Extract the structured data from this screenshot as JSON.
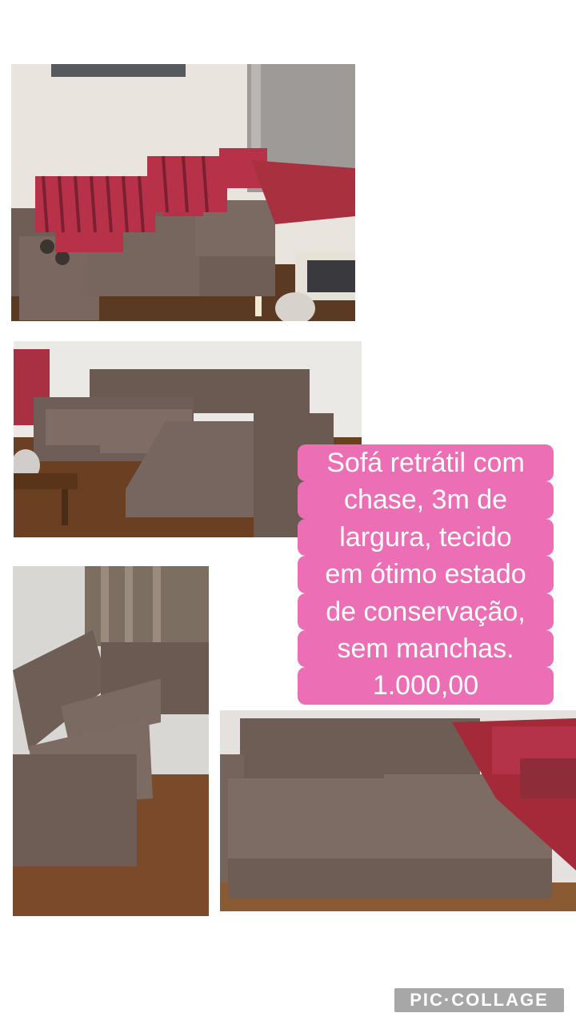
{
  "caption": {
    "lines": [
      "Sofá retrátil com",
      "chase, 3m de",
      "largura, tecido",
      "em ótimo estado",
      "de conservação,",
      "sem manchas.",
      "1.000,00"
    ],
    "highlight_color": "#ec6fb6",
    "text_color": "#ffffff"
  },
  "watermark": {
    "text": "PIC·COLLAGE"
  },
  "photos": [
    {
      "id": "photo-1",
      "subject": "brown sectional sofa with red striped cushions in living room"
    },
    {
      "id": "photo-2",
      "subject": "brown L-shaped sofa with chaise"
    },
    {
      "id": "photo-3",
      "subject": "sofa seen from the corner near window curtains"
    },
    {
      "id": "photo-4",
      "subject": "close view of sofa seat cushions"
    }
  ],
  "colors": {
    "fabric": "#6f5f58",
    "floor": "#8a5a32",
    "wall": "#ece9e4",
    "stripe": "#b8324a"
  }
}
